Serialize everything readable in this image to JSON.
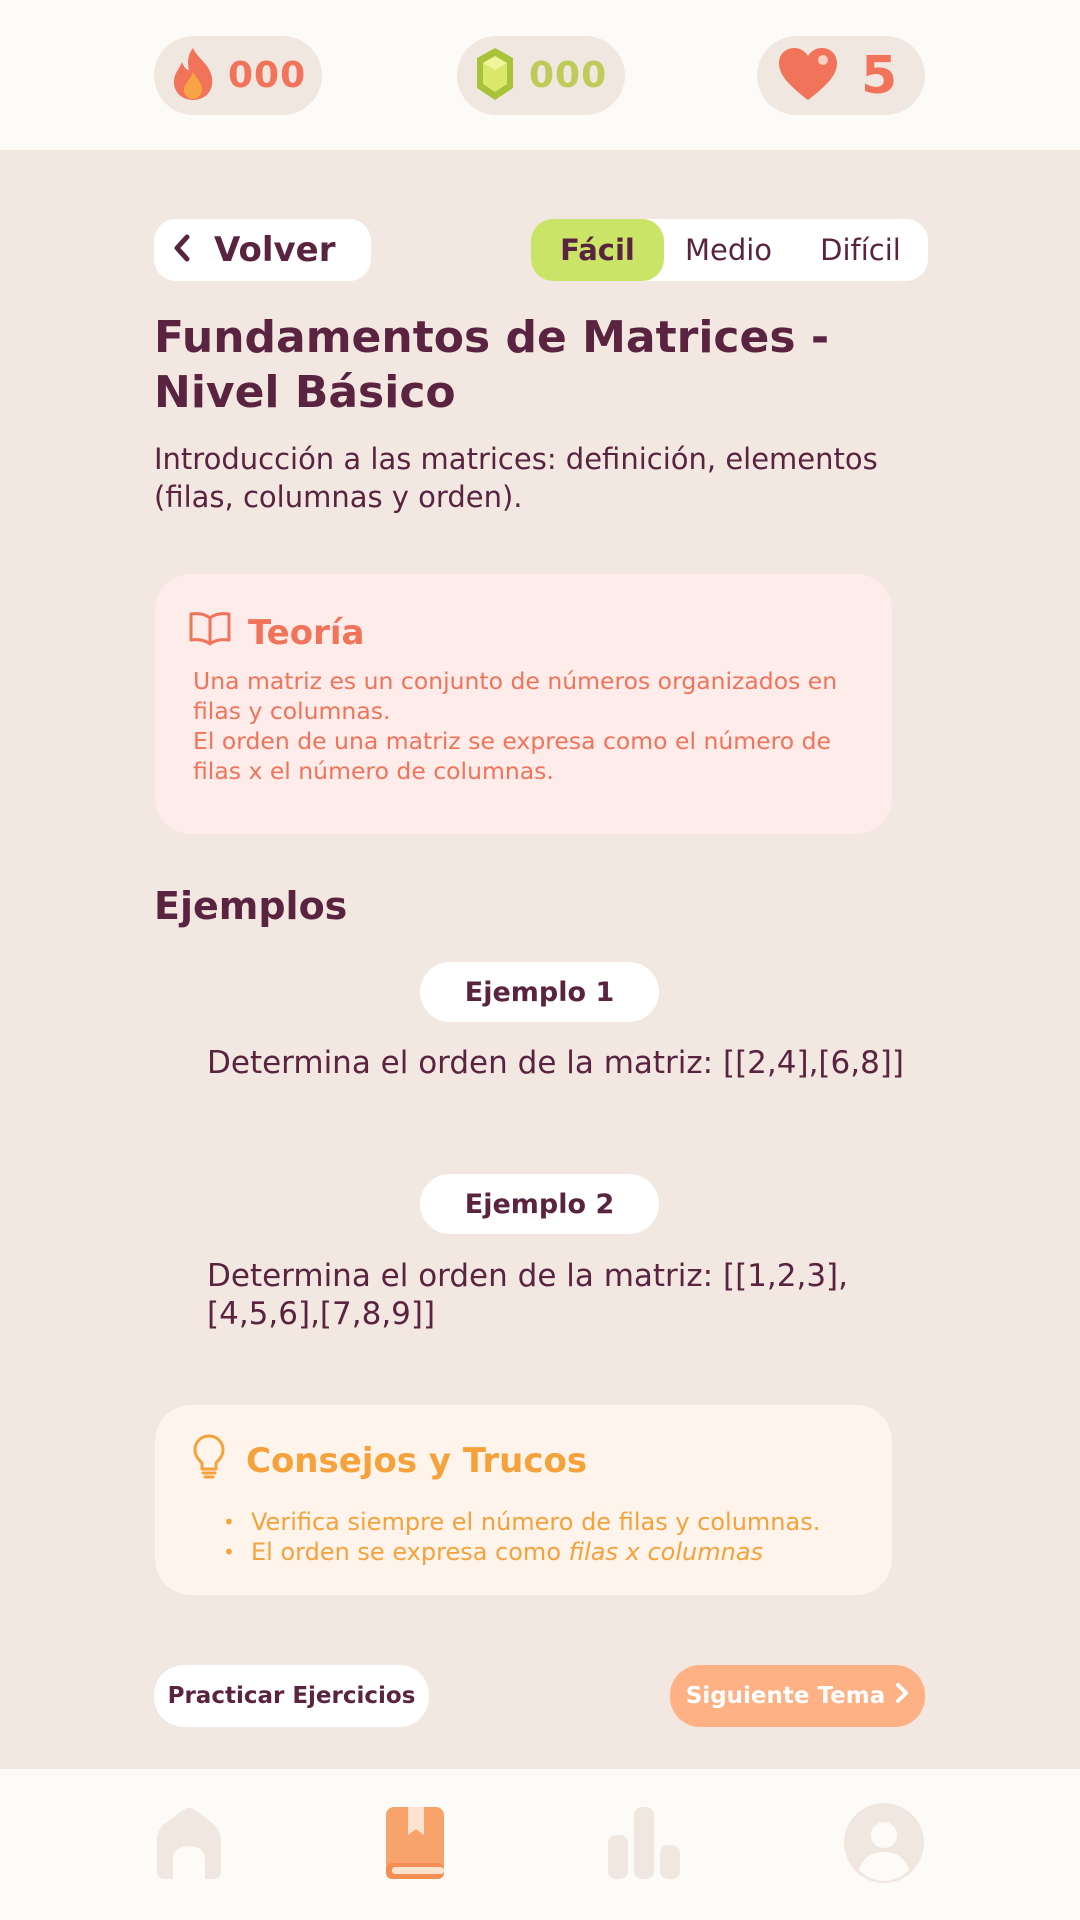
{
  "stats": {
    "streak": "000",
    "gems": "000",
    "lives": "5"
  },
  "nav": {
    "back_label": "Volver",
    "levels": [
      "Fácil",
      "Medio",
      "Difícil"
    ],
    "active_level": "Fácil"
  },
  "lesson": {
    "title": "Fundamentos de Matrices -  Nivel Básico",
    "subtitle": "Introducción a las matrices: definición, elementos (filas, columnas y orden)."
  },
  "theory": {
    "heading": "Teoría",
    "line1": "Una matriz es un conjunto de números organizados en filas y columnas.",
    "line2": "El orden de una matriz se expresa como el número de filas x  el número de columnas."
  },
  "examples": {
    "heading": "Ejemplos",
    "items": [
      {
        "label": "Ejemplo 1",
        "text": "Determina el orden de la matriz: [[2,4],[6,8]]"
      },
      {
        "label": "Ejemplo 2",
        "text": "Determina el orden de la matriz: [[1,2,3],[4,5,6],[7,8,9]]"
      }
    ]
  },
  "tips": {
    "heading": "Consejos y Trucos",
    "item1": "Verifica siempre el número de filas y columnas.",
    "item2_prefix": "El orden se expresa como ",
    "item2_em": "filas x columnas"
  },
  "actions": {
    "practice_label": "Practicar Ejercicios",
    "next_label": "Siguiente Tema"
  },
  "bottom_nav": [
    "home-icon",
    "book-icon",
    "stats-icon",
    "profile-icon"
  ],
  "colors": {
    "background": "#f2e8e1",
    "text": "#5a2340",
    "accent_green": "#c9e466",
    "theory": "#f0735a",
    "tips": "#f6a23c",
    "next_button": "#fdb184",
    "nav_active": "#f7a36b",
    "nav_inactive": "#f1e7e1"
  }
}
